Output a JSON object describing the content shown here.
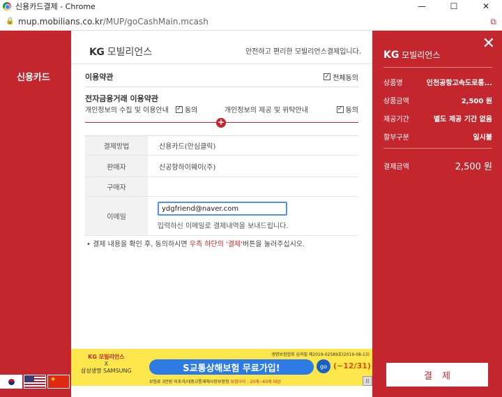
{
  "window": {
    "title": "신용카드결제 - Chrome",
    "minimize": "—",
    "maximize": "☐",
    "close": "✕"
  },
  "address": {
    "host": "mup.mobilians.co.kr",
    "path": "/MUP/goCashMain.mcash"
  },
  "left": {
    "title": "신용카드"
  },
  "header": {
    "logo_kg": "KG",
    "logo_text": "모빌리언스",
    "slogan": "안전하고 편리한 모빌리언스결제입니다."
  },
  "terms": {
    "title": "이용약관",
    "agree_all": "전체동의",
    "ef_title": "전자금융거래 이용약관",
    "item1": "개인정보의 수집 및 이용안내",
    "item2": "개인정보의 제공 및 위탁안내",
    "agree": "동의"
  },
  "info": {
    "rows": [
      {
        "label": "결제방법",
        "value": "신용카드(안심클릭)"
      },
      {
        "label": "판매자",
        "value": "신공항하이웨이(주)"
      },
      {
        "label": "구매자",
        "value": ""
      }
    ],
    "email_label": "이메일",
    "email_value": "ydgfriend@naver.com",
    "email_note": "입력하신 이메일로 결제내역을 보내드립니다."
  },
  "notice": {
    "prefix": "• 결제 내용을 확인 후, 동의하시면 ",
    "highlight": "우측 하단의 '결제'",
    "suffix": "버튼을 눌러주십시오."
  },
  "banner": {
    "logo_kg": "KG 모빌리언스",
    "x": "X",
    "partner": "삼성생명 SAMSUNG",
    "meta": "생명보험협회 심의필 제2019-02589호(2019-08-13)",
    "main": "S교통상해보험 무료가입!",
    "go": "go",
    "period": "(~12/31)",
    "fine_prefix": "보험료 3만원 미초과/대중교통재해사망보장형 ",
    "fine_red": "보험나이 : 20세~60세 대상",
    "scroll": "II"
  },
  "summary": {
    "logo_kg": "KG",
    "logo_text": "모빌리언스",
    "rows": [
      {
        "k": "상품명",
        "v": "인천공항고속도로통..."
      },
      {
        "k": "상품금액",
        "v": "2,500 원"
      },
      {
        "k": "제공기간",
        "v": "별도 제공 기간 없음"
      },
      {
        "k": "할부구분",
        "v": "일시불"
      }
    ],
    "total_label": "결제금액",
    "total_value": "2,500 원",
    "close": "✕",
    "pay_button": "결제"
  },
  "colors": {
    "brand_red": "#c4262e",
    "input_focus": "#4d90fe",
    "banner_yellow": "#fde74c"
  }
}
